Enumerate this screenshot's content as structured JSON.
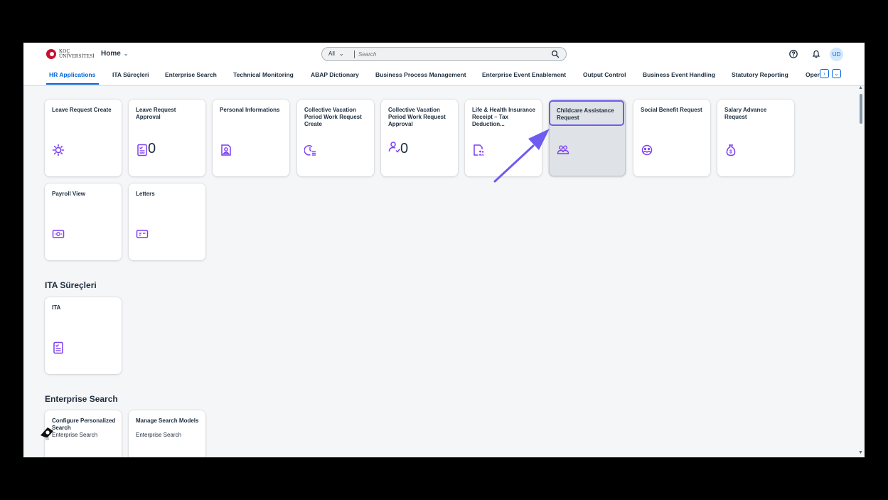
{
  "header": {
    "logo_lines": [
      "KOÇ",
      "ÜNİVERSİTESİ"
    ],
    "home_label": "Home",
    "search_scope": "All",
    "search_placeholder": "Search",
    "avatar_initials": "UD"
  },
  "tabs": [
    {
      "label": "HR Applications",
      "active": true
    },
    {
      "label": "ITA Süreçleri"
    },
    {
      "label": "Enterprise Search"
    },
    {
      "label": "Technical Monitoring"
    },
    {
      "label": "ABAP Dictionary"
    },
    {
      "label": "Business Process Management"
    },
    {
      "label": "Enterprise Event Enablement"
    },
    {
      "label": "Output Control"
    },
    {
      "label": "Business Event Handling"
    },
    {
      "label": "Statutory Reporting"
    },
    {
      "label": "Oper"
    }
  ],
  "sections": {
    "ita": {
      "title": "ITA Süreçleri"
    },
    "enterprise": {
      "title": "Enterprise Search"
    }
  },
  "tiles": {
    "leave_request_create": {
      "title": "Leave Request Create",
      "icon": "settings-sun-icon"
    },
    "leave_request_approval": {
      "title": "Leave Request Approval",
      "count": "0",
      "icon": "checklist-icon"
    },
    "personal_informations": {
      "title": "Personal Informations",
      "icon": "person-card-icon"
    },
    "collective_vacation_create": {
      "title": "Collective Vacation Period Work Request Create",
      "icon": "clock-list-icon"
    },
    "collective_vacation_approval": {
      "title": "Collective Vacation Period Work Request Approval",
      "count": "0",
      "icon": "person-check-icon"
    },
    "life_health": {
      "title": "Life & Health Insurance Receipt – Tax Deduction...",
      "icon": "document-people-icon"
    },
    "childcare": {
      "title": "Childcare Assistance Request",
      "icon": "group-icon"
    },
    "social_benefit": {
      "title": "Social Benefit Request",
      "icon": "people-circle-icon"
    },
    "salary_advance": {
      "title": "Salary Advance Request",
      "icon": "money-bag-icon"
    },
    "payroll_view": {
      "title": "Payroll View",
      "icon": "money-bills-icon"
    },
    "letters": {
      "title": "Letters",
      "icon": "card-icon"
    },
    "ita": {
      "title": "ITA",
      "icon": "checklist-icon"
    },
    "configure_search": {
      "title": "Configure Personalized Search",
      "subtitle": "Enterprise Search"
    },
    "manage_models": {
      "title": "Manage Search Models",
      "subtitle": "Enterprise Search"
    }
  },
  "colors": {
    "accent": "#0064d9",
    "icon_purple": "#7b3ff2",
    "annotation": "#6e5cf0"
  }
}
